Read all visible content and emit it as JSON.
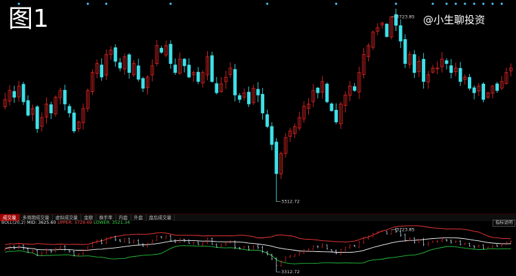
{
  "figure_label": "图1",
  "watermark": "@小生聊投资",
  "tabs": [
    "成交量",
    "多周期成交量",
    "虚拟成交量",
    "金额",
    "换手率",
    "内盘",
    "外盘",
    "盘后成交量"
  ],
  "active_tab": 0,
  "indicator": {
    "name": "BOLL(20,2)",
    "mid": "MID: 3625.60",
    "upper": "UPPER: 3729.69",
    "lower": "LOWER: 3521.34",
    "button_label": "指标说明"
  },
  "colors": {
    "up": "#e02424",
    "down": "#3fe0e8",
    "background": "#000000",
    "upper_band": "#ff3b3b",
    "mid_band": "#ffffff",
    "lower_band": "#25c43c",
    "marker": "#4fc3f7"
  },
  "chart_data": [
    {
      "type": "candlestick",
      "x_axis_labels": "none",
      "y_axis_labels": "none",
      "annotations": [
        {
          "label": "3723.85",
          "kind": "high"
        },
        {
          "label": "3312.72",
          "kind": "low"
        }
      ],
      "close": [
        3540,
        3560,
        3545,
        3570,
        3535,
        3505,
        3520,
        3475,
        3500,
        3530,
        3510,
        3545,
        3560,
        3530,
        3510,
        3470,
        3490,
        3520,
        3560,
        3600,
        3620,
        3590,
        3640,
        3650,
        3625,
        3610,
        3635,
        3600,
        3620,
        3585,
        3565,
        3590,
        3615,
        3660,
        3645,
        3660,
        3620,
        3600,
        3630,
        3615,
        3590,
        3600,
        3580,
        3600,
        3635,
        3580,
        3555,
        3575,
        3590,
        3610,
        3550,
        3540,
        3555,
        3530,
        3565,
        3550,
        3510,
        3480,
        3440,
        3375,
        3420,
        3455,
        3470,
        3480,
        3500,
        3525,
        3530,
        3560,
        3555,
        3580,
        3535,
        3515,
        3490,
        3530,
        3550,
        3570,
        3560,
        3600,
        3640,
        3660,
        3690,
        3700,
        3710,
        3680,
        3724,
        3705,
        3670,
        3620,
        3640,
        3600,
        3625,
        3580,
        3595,
        3610,
        3610,
        3630,
        3620,
        3600,
        3610,
        3580,
        3590,
        3565,
        3555,
        3570,
        3540,
        3555,
        3570,
        3560,
        3580,
        3600,
        3610
      ],
      "ohlc_note": "open, high and low per candle are generated in the drawing script from close"
    },
    {
      "type": "line",
      "indicator": "BOLL(20,2)",
      "series": [
        {
          "name": "MID",
          "value": 3625.6
        },
        {
          "name": "UPPER",
          "value": 3729.69
        },
        {
          "name": "LOWER",
          "value": 3521.34
        }
      ]
    }
  ]
}
